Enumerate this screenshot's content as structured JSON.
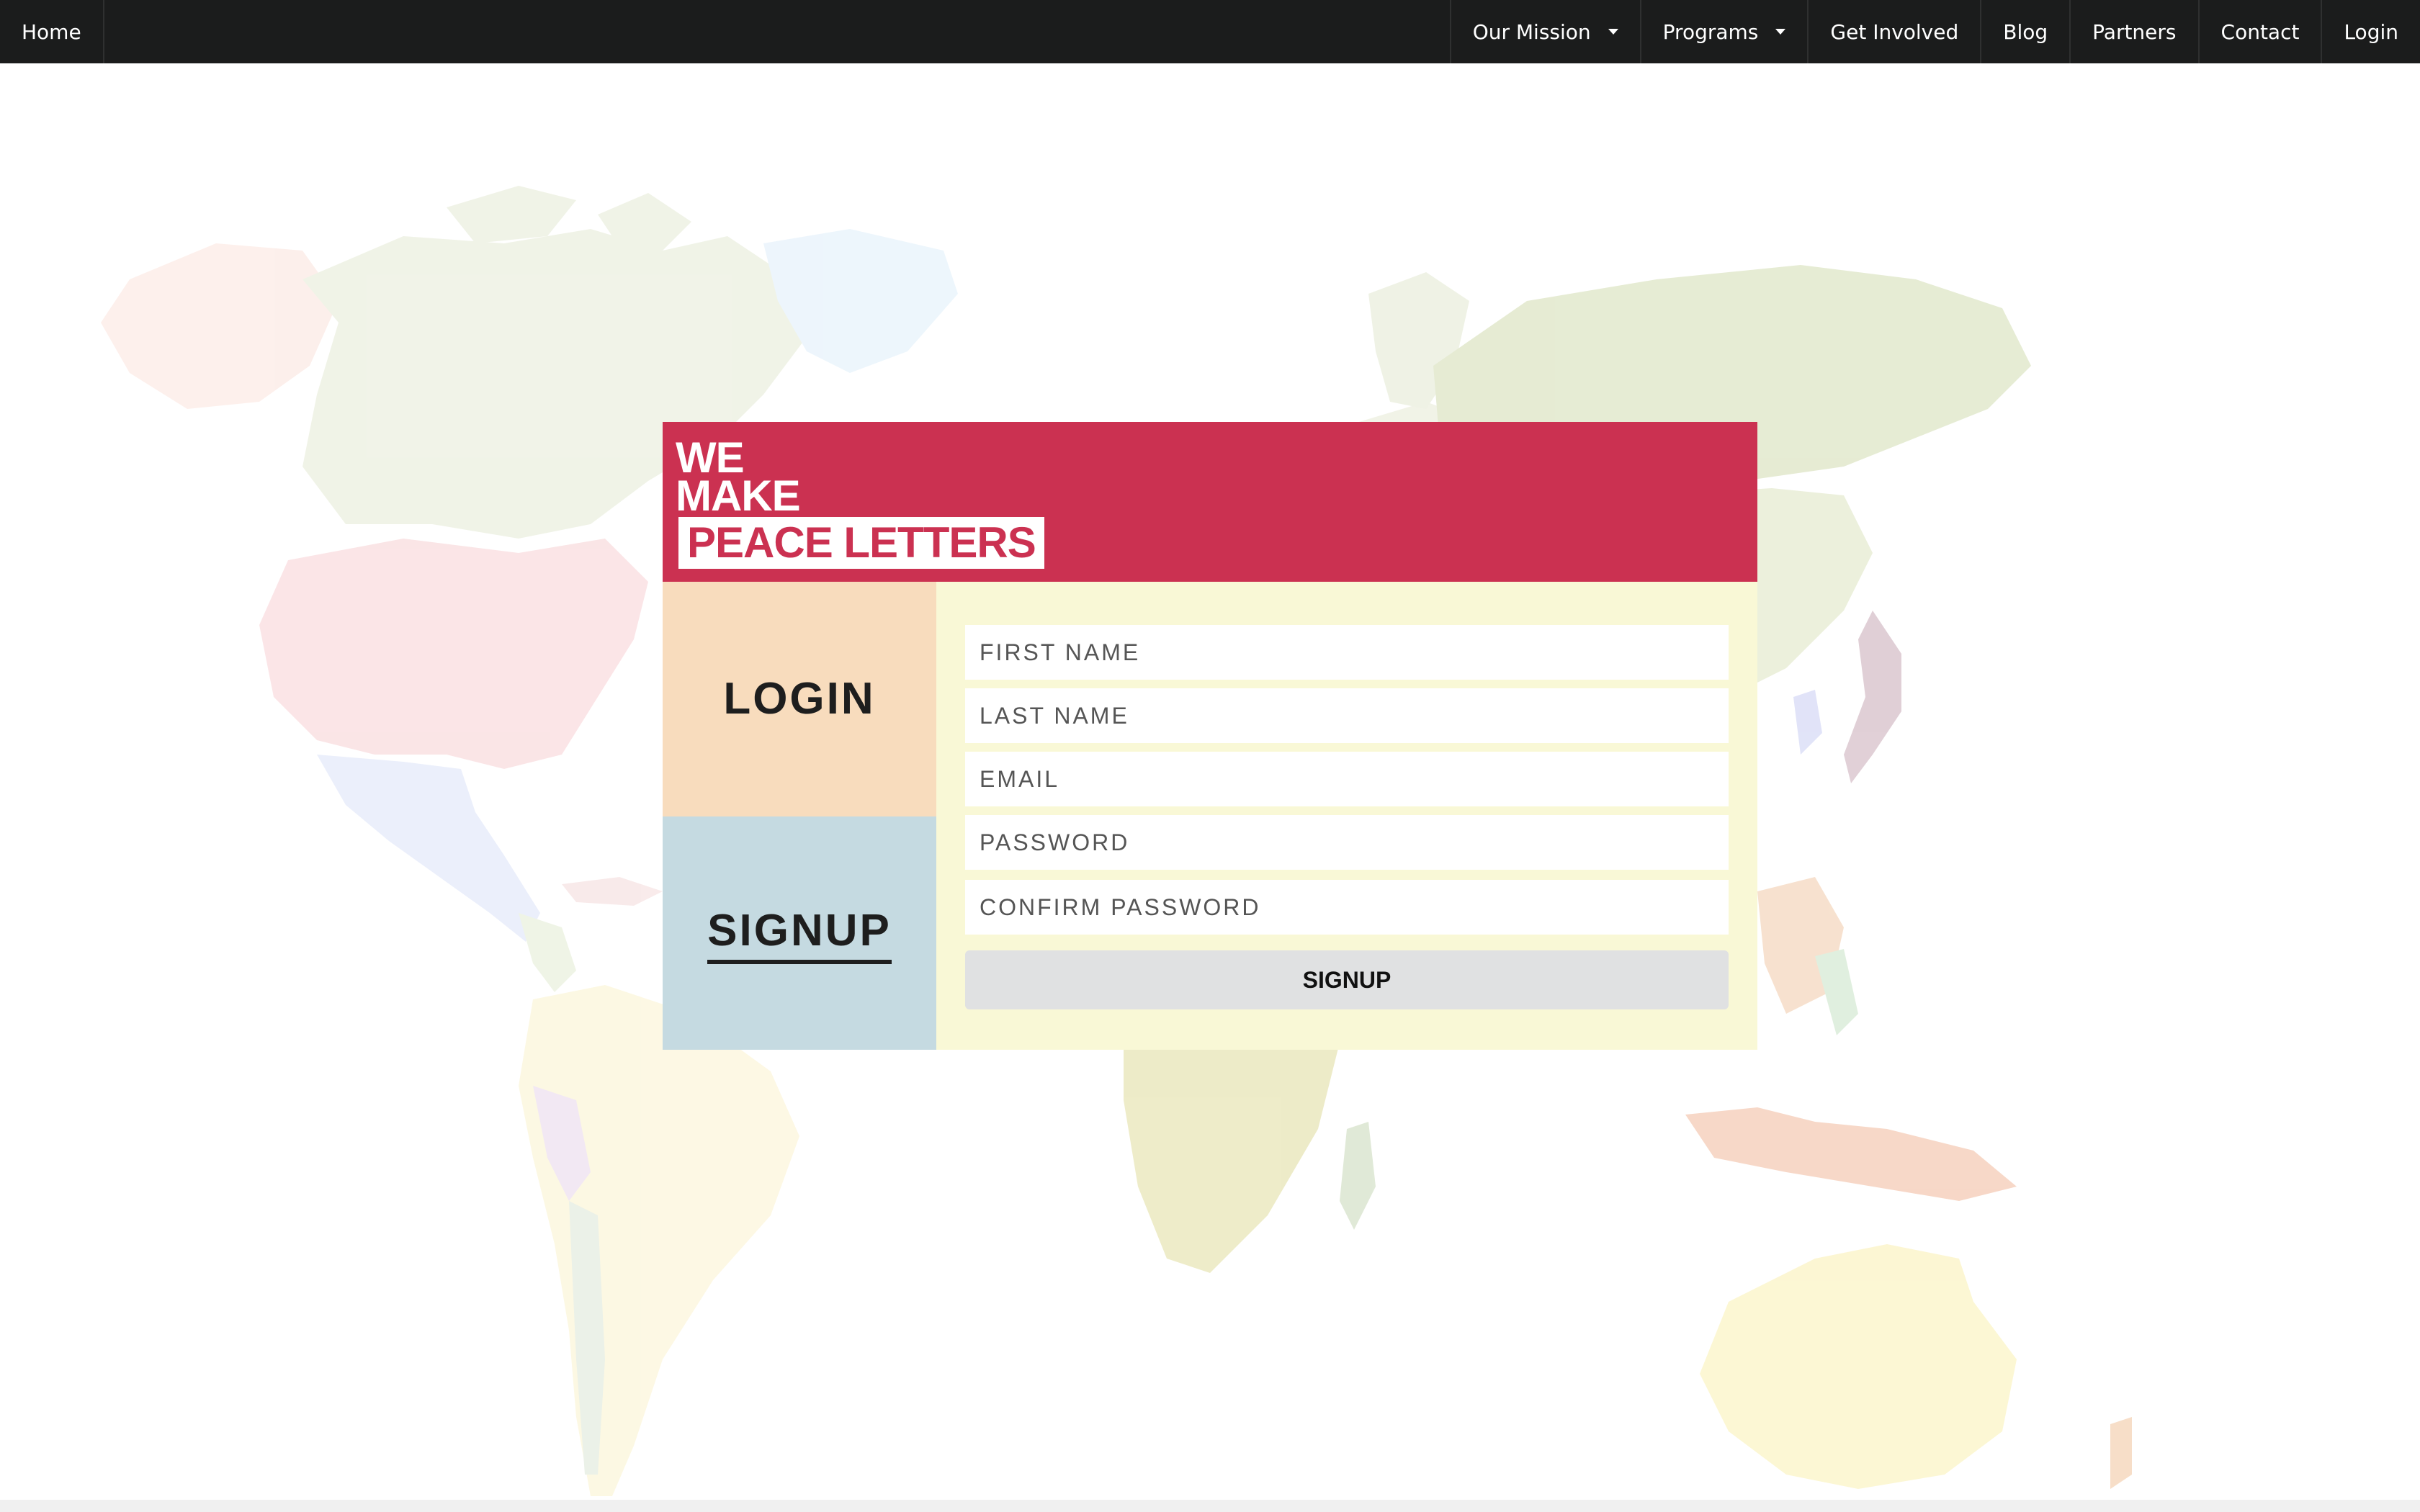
{
  "nav": {
    "home": "Home",
    "our_mission": "Our Mission",
    "programs": "Programs",
    "get_involved": "Get Involved",
    "blog": "Blog",
    "partners": "Partners",
    "contact": "Contact",
    "login": "Login"
  },
  "logo": {
    "line1": "WE",
    "line2": "MAKE",
    "line3": "PEACE LETTERS"
  },
  "tabs": {
    "login": "LOGIN",
    "signup": "SIGNUP"
  },
  "form": {
    "first_name_placeholder": "FIRST NAME",
    "last_name_placeholder": "LAST NAME",
    "email_placeholder": "EMAIL",
    "password_placeholder": "PASSWORD",
    "confirm_password_placeholder": "CONFIRM PASSWORD",
    "submit_label": "SIGNUP"
  },
  "colors": {
    "nav_background": "#1b1c1c",
    "brand_red": "#cb3151",
    "login_tab": "#f8dcbd",
    "signup_tab": "#c5dae1",
    "form_panel": "#f9f8d6",
    "submit_button": "#e0e1e2"
  },
  "icons": {
    "dropdown": "caret-down-icon",
    "background": "world-map"
  }
}
